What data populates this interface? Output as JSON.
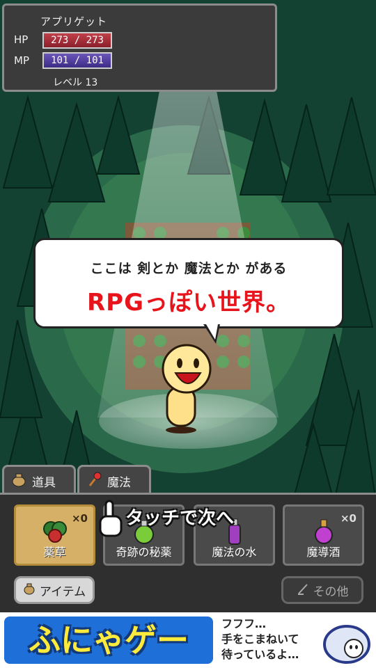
{
  "status": {
    "name": "アプリゲット",
    "hp_label": "HP",
    "hp_value": "273 / 273",
    "mp_label": "MP",
    "mp_value": "101 / 101",
    "level": "レベル 13"
  },
  "dialog": {
    "line1": "ここは 剣とか 魔法とか がある",
    "line2": "RPGっぽい世界。"
  },
  "tabs": [
    {
      "label": "道具",
      "icon": "bag-icon"
    },
    {
      "label": "魔法",
      "icon": "wand-icon"
    }
  ],
  "hint": "タッチで次へ",
  "items": [
    {
      "name": "薬草",
      "count": "×0",
      "icon": "herb-icon"
    },
    {
      "name": "奇跡の秘薬",
      "count": "",
      "icon": "potion-icon"
    },
    {
      "name": "魔法の水",
      "count": "",
      "icon": "water-icon"
    },
    {
      "name": "魔導酒",
      "count": "×0",
      "icon": "flask-icon"
    }
  ],
  "buttons": {
    "item": "アイテム",
    "other": "その他"
  },
  "ad": {
    "logo": "ふにゃゲー",
    "line1": "フフフ…",
    "line2": "手をこまねいて",
    "line3": "待っているよ…"
  },
  "colors": {
    "hp_bar": "#a8323c",
    "mp_bar": "#4e3b9c",
    "highlight_text": "#e8141c",
    "slot_bg": "#d6b067"
  }
}
